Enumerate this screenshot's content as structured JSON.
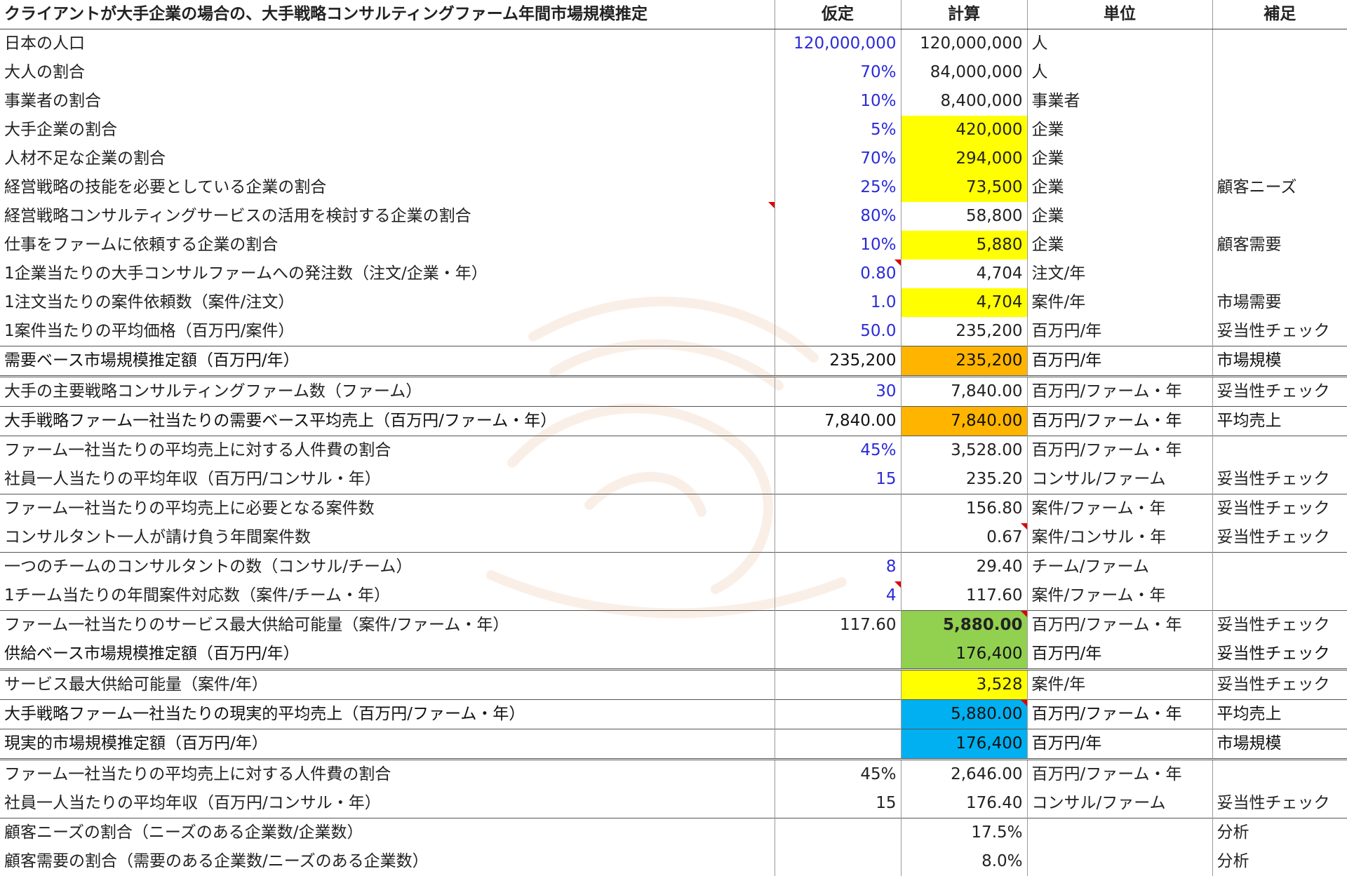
{
  "headers": {
    "title": "クライアントが大手企業の場合の、大手戦略コンサルティングファーム年間市場規模推定",
    "assumption": "仮定",
    "calc": "計算",
    "unit": "単位",
    "note": "補足"
  },
  "rows": [
    {
      "label": "日本の人口",
      "assumption": "120,000,000",
      "calc": "120,000,000",
      "unit": "人",
      "note": ""
    },
    {
      "label": "大人の割合",
      "assumption": "70%",
      "calc": "84,000,000",
      "unit": "人",
      "note": ""
    },
    {
      "label": "事業者の割合",
      "assumption": "10%",
      "calc": "8,400,000",
      "unit": "事業者",
      "note": ""
    },
    {
      "label": "大手企業の割合",
      "assumption": "5%",
      "calc": "420,000",
      "unit": "企業",
      "note": ""
    },
    {
      "label": "人材不足な企業の割合",
      "assumption": "70%",
      "calc": "294,000",
      "unit": "企業",
      "note": ""
    },
    {
      "label": "経営戦略の技能を必要としている企業の割合",
      "assumption": "25%",
      "calc": "73,500",
      "unit": "企業",
      "note": "顧客ニーズ"
    },
    {
      "label": "経営戦略コンサルティングサービスの活用を検討する企業の割合",
      "assumption": "80%",
      "calc": "58,800",
      "unit": "企業",
      "note": ""
    },
    {
      "label": "仕事をファームに依頼する企業の割合",
      "assumption": "10%",
      "calc": "5,880",
      "unit": "企業",
      "note": "顧客需要"
    },
    {
      "label": "1企業当たりの大手コンサルファームへの発注数（注文/企業・年）",
      "assumption": "0.80",
      "calc": "4,704",
      "unit": "注文/年",
      "note": ""
    },
    {
      "label": "1注文当たりの案件依頼数（案件/注文）",
      "assumption": "1.0",
      "calc": "4,704",
      "unit": "案件/年",
      "note": "市場需要"
    },
    {
      "label": "1案件当たりの平均価格（百万円/案件）",
      "assumption": "50.0",
      "calc": "235,200",
      "unit": "百万円/年",
      "note": "妥当性チェック"
    },
    {
      "label": "需要ベース市場規模推定額（百万円/年）",
      "assumption": "235,200",
      "calc": "235,200",
      "unit": "百万円/年",
      "note": "市場規模"
    },
    {
      "label": "大手の主要戦略コンサルティングファーム数（ファーム）",
      "assumption": "30",
      "calc": "7,840.00",
      "unit": "百万円/ファーム・年",
      "note": "妥当性チェック"
    },
    {
      "label": "大手戦略ファーム一社当たりの需要ベース平均売上（百万円/ファーム・年）",
      "assumption": "7,840.00",
      "calc": "7,840.00",
      "unit": "百万円/ファーム・年",
      "note": "平均売上"
    },
    {
      "label": "ファーム一社当たりの平均売上に対する人件費の割合",
      "assumption": "45%",
      "calc": "3,528.00",
      "unit": "百万円/ファーム・年",
      "note": ""
    },
    {
      "label": "社員一人当たりの平均年収（百万円/コンサル・年）",
      "assumption": "15",
      "calc": "235.20",
      "unit": "コンサル/ファーム",
      "note": "妥当性チェック"
    },
    {
      "label": "ファーム一社当たりの平均売上に必要となる案件数",
      "assumption": "",
      "calc": "156.80",
      "unit": "案件/ファーム・年",
      "note": "妥当性チェック"
    },
    {
      "label": "コンサルタント一人が請け負う年間案件数",
      "assumption": "",
      "calc": "0.67",
      "unit": "案件/コンサル・年",
      "note": "妥当性チェック"
    },
    {
      "label": "一つのチームのコンサルタントの数（コンサル/チーム）",
      "assumption": "8",
      "calc": "29.40",
      "unit": "チーム/ファーム",
      "note": ""
    },
    {
      "label": "1チーム当たりの年間案件対応数（案件/チーム・年）",
      "assumption": "4",
      "calc": "117.60",
      "unit": "案件/ファーム・年",
      "note": ""
    },
    {
      "label": "ファーム一社当たりのサービス最大供給可能量（案件/ファーム・年）",
      "assumption": "117.60",
      "calc": "5,880.00",
      "unit": "百万円/ファーム・年",
      "note": "妥当性チェック"
    },
    {
      "label": "供給ベース市場規模推定額（百万円/年）",
      "assumption": "",
      "calc": "176,400",
      "unit": "百万円/年",
      "note": "妥当性チェック"
    },
    {
      "label": "サービス最大供給可能量（案件/年）",
      "assumption": "",
      "calc": "3,528",
      "unit": "案件/年",
      "note": "妥当性チェック"
    },
    {
      "label": "大手戦略ファーム一社当たりの現実的平均売上（百万円/ファーム・年）",
      "assumption": "",
      "calc": "5,880.00",
      "unit": "百万円/ファーム・年",
      "note": "平均売上"
    },
    {
      "label": "現実的市場規模推定額（百万円/年）",
      "assumption": "",
      "calc": "176,400",
      "unit": "百万円/年",
      "note": "市場規模"
    },
    {
      "label": "ファーム一社当たりの平均売上に対する人件費の割合",
      "assumption": "45%",
      "calc": "2,646.00",
      "unit": "百万円/ファーム・年",
      "note": ""
    },
    {
      "label": "社員一人当たりの平均年収（百万円/コンサル・年）",
      "assumption": "15",
      "calc": "176.40",
      "unit": "コンサル/ファーム",
      "note": "妥当性チェック"
    },
    {
      "label": "顧客ニーズの割合（ニーズのある企業数/企業数）",
      "assumption": "",
      "calc": "17.5%",
      "unit": "",
      "note": "分析"
    },
    {
      "label": "顧客需要の割合（需要のある企業数/ニーズのある企業数）",
      "assumption": "",
      "calc": "8.0%",
      "unit": "",
      "note": "分析"
    }
  ],
  "colors": {
    "input_blue": "#2b2bd8",
    "yellow": "#ffff00",
    "orange": "#ffb400",
    "green": "#92d050",
    "blue": "#00b0f0",
    "comment_marker": "#e00000"
  }
}
